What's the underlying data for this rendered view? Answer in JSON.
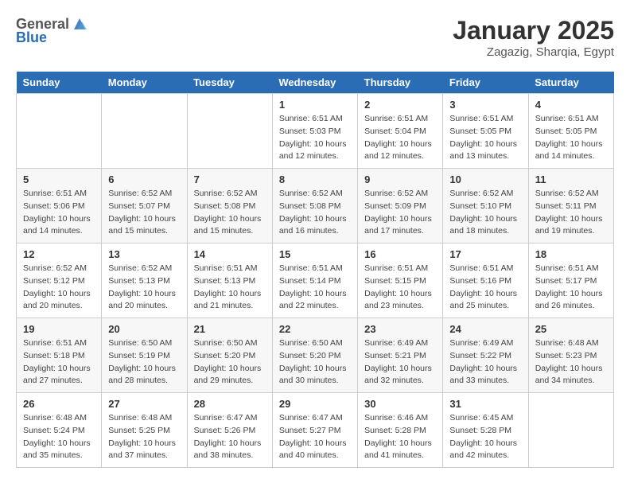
{
  "header": {
    "logo_general": "General",
    "logo_blue": "Blue",
    "title": "January 2025",
    "subtitle": "Zagazig, Sharqia, Egypt"
  },
  "days_of_week": [
    "Sunday",
    "Monday",
    "Tuesday",
    "Wednesday",
    "Thursday",
    "Friday",
    "Saturday"
  ],
  "weeks": [
    [
      {
        "day": "",
        "info": ""
      },
      {
        "day": "",
        "info": ""
      },
      {
        "day": "",
        "info": ""
      },
      {
        "day": "1",
        "info": "Sunrise: 6:51 AM\nSunset: 5:03 PM\nDaylight: 10 hours and 12 minutes."
      },
      {
        "day": "2",
        "info": "Sunrise: 6:51 AM\nSunset: 5:04 PM\nDaylight: 10 hours and 12 minutes."
      },
      {
        "day": "3",
        "info": "Sunrise: 6:51 AM\nSunset: 5:05 PM\nDaylight: 10 hours and 13 minutes."
      },
      {
        "day": "4",
        "info": "Sunrise: 6:51 AM\nSunset: 5:05 PM\nDaylight: 10 hours and 14 minutes."
      }
    ],
    [
      {
        "day": "5",
        "info": "Sunrise: 6:51 AM\nSunset: 5:06 PM\nDaylight: 10 hours and 14 minutes."
      },
      {
        "day": "6",
        "info": "Sunrise: 6:52 AM\nSunset: 5:07 PM\nDaylight: 10 hours and 15 minutes."
      },
      {
        "day": "7",
        "info": "Sunrise: 6:52 AM\nSunset: 5:08 PM\nDaylight: 10 hours and 15 minutes."
      },
      {
        "day": "8",
        "info": "Sunrise: 6:52 AM\nSunset: 5:08 PM\nDaylight: 10 hours and 16 minutes."
      },
      {
        "day": "9",
        "info": "Sunrise: 6:52 AM\nSunset: 5:09 PM\nDaylight: 10 hours and 17 minutes."
      },
      {
        "day": "10",
        "info": "Sunrise: 6:52 AM\nSunset: 5:10 PM\nDaylight: 10 hours and 18 minutes."
      },
      {
        "day": "11",
        "info": "Sunrise: 6:52 AM\nSunset: 5:11 PM\nDaylight: 10 hours and 19 minutes."
      }
    ],
    [
      {
        "day": "12",
        "info": "Sunrise: 6:52 AM\nSunset: 5:12 PM\nDaylight: 10 hours and 20 minutes."
      },
      {
        "day": "13",
        "info": "Sunrise: 6:52 AM\nSunset: 5:13 PM\nDaylight: 10 hours and 20 minutes."
      },
      {
        "day": "14",
        "info": "Sunrise: 6:51 AM\nSunset: 5:13 PM\nDaylight: 10 hours and 21 minutes."
      },
      {
        "day": "15",
        "info": "Sunrise: 6:51 AM\nSunset: 5:14 PM\nDaylight: 10 hours and 22 minutes."
      },
      {
        "day": "16",
        "info": "Sunrise: 6:51 AM\nSunset: 5:15 PM\nDaylight: 10 hours and 23 minutes."
      },
      {
        "day": "17",
        "info": "Sunrise: 6:51 AM\nSunset: 5:16 PM\nDaylight: 10 hours and 25 minutes."
      },
      {
        "day": "18",
        "info": "Sunrise: 6:51 AM\nSunset: 5:17 PM\nDaylight: 10 hours and 26 minutes."
      }
    ],
    [
      {
        "day": "19",
        "info": "Sunrise: 6:51 AM\nSunset: 5:18 PM\nDaylight: 10 hours and 27 minutes."
      },
      {
        "day": "20",
        "info": "Sunrise: 6:50 AM\nSunset: 5:19 PM\nDaylight: 10 hours and 28 minutes."
      },
      {
        "day": "21",
        "info": "Sunrise: 6:50 AM\nSunset: 5:20 PM\nDaylight: 10 hours and 29 minutes."
      },
      {
        "day": "22",
        "info": "Sunrise: 6:50 AM\nSunset: 5:20 PM\nDaylight: 10 hours and 30 minutes."
      },
      {
        "day": "23",
        "info": "Sunrise: 6:49 AM\nSunset: 5:21 PM\nDaylight: 10 hours and 32 minutes."
      },
      {
        "day": "24",
        "info": "Sunrise: 6:49 AM\nSunset: 5:22 PM\nDaylight: 10 hours and 33 minutes."
      },
      {
        "day": "25",
        "info": "Sunrise: 6:48 AM\nSunset: 5:23 PM\nDaylight: 10 hours and 34 minutes."
      }
    ],
    [
      {
        "day": "26",
        "info": "Sunrise: 6:48 AM\nSunset: 5:24 PM\nDaylight: 10 hours and 35 minutes."
      },
      {
        "day": "27",
        "info": "Sunrise: 6:48 AM\nSunset: 5:25 PM\nDaylight: 10 hours and 37 minutes."
      },
      {
        "day": "28",
        "info": "Sunrise: 6:47 AM\nSunset: 5:26 PM\nDaylight: 10 hours and 38 minutes."
      },
      {
        "day": "29",
        "info": "Sunrise: 6:47 AM\nSunset: 5:27 PM\nDaylight: 10 hours and 40 minutes."
      },
      {
        "day": "30",
        "info": "Sunrise: 6:46 AM\nSunset: 5:28 PM\nDaylight: 10 hours and 41 minutes."
      },
      {
        "day": "31",
        "info": "Sunrise: 6:45 AM\nSunset: 5:28 PM\nDaylight: 10 hours and 42 minutes."
      },
      {
        "day": "",
        "info": ""
      }
    ]
  ]
}
